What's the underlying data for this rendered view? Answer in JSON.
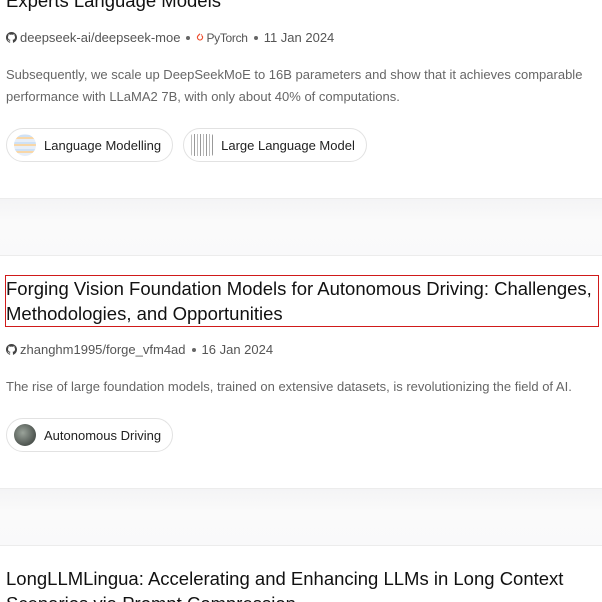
{
  "papers": [
    {
      "title": "Experts Language Models",
      "repo": "deepseek-ai/deepseek-moe",
      "framework": "PyTorch",
      "date": "11 Jan 2024",
      "abstract": "Subsequently, we scale up DeepSeekMoE to 16B parameters and show that it achieves comparable performance with LLaMA2 7B, with only about 40% of computations.",
      "tags": [
        "Language Modelling",
        "Large Language Model"
      ]
    },
    {
      "title": "Forging Vision Foundation Models for Autonomous Driving: Challenges, Methodologies, and Opportunities",
      "repo": "zhanghm1995/forge_vfm4ad",
      "date": "16 Jan 2024",
      "abstract": "The rise of large foundation models, trained on extensive datasets, is revolutionizing the field of AI.",
      "tags": [
        "Autonomous Driving"
      ]
    },
    {
      "title": "LongLLMLingua: Accelerating and Enhancing LLMs in Long Context Scenarios via Prompt Compression"
    }
  ],
  "colors": {
    "highlight": "#d01a1a",
    "pytorch": "#ee4c2c"
  }
}
